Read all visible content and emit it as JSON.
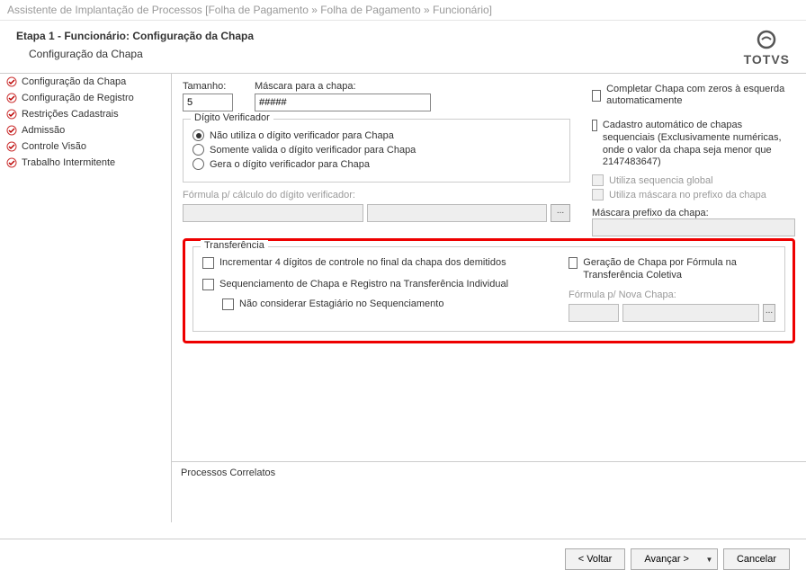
{
  "window_title": "Assistente de Implantação de Processos [Folha de Pagamento » Folha de Pagamento » Funcionário]",
  "step_title": "Etapa 1 - Funcionário: Configuração da Chapa",
  "step_subtitle": "Configuração da Chapa",
  "brand": "TOTVS",
  "sidebar": {
    "items": [
      {
        "label": "Configuração da Chapa"
      },
      {
        "label": "Configuração de Registro"
      },
      {
        "label": "Restrições Cadastrais"
      },
      {
        "label": "Admissão"
      },
      {
        "label": "Controle Visão"
      },
      {
        "label": "Trabalho Intermitente"
      }
    ]
  },
  "form": {
    "tamanho_label": "Tamanho:",
    "tamanho_value": "5",
    "mascara_label": "Máscara para a chapa:",
    "mascara_value": "#####",
    "completar_label": "Completar Chapa com zeros à esquerda automaticamente",
    "dv_legend": "Dígito Verificador",
    "dv_opt1": "Não utiliza o dígito verificador para Chapa",
    "dv_opt2": "Somente valida o dígito verificador para Chapa",
    "dv_opt3": "Gera o dígito verificador para Chapa",
    "cadastro_auto_label": "Cadastro automático de chapas sequenciais (Exclusivamente numéricas, onde o valor da chapa seja menor que 2147483647)",
    "seq_global_label": "Utiliza sequencia global",
    "mascara_prefixo_chk_label": "Utiliza máscara no prefixo da chapa",
    "formula_calc_label": "Fórmula p/ cálculo do dígito verificador:",
    "mascara_prefixo_label": "Máscara prefixo da chapa:",
    "transfer_legend": "Transferência",
    "t_inc_label": "Incrementar 4 dígitos de controle no final da chapa dos demitidos",
    "t_ger_label": "Geração de Chapa por Fórmula na Transferência Coletiva",
    "t_seq_label": "Sequenciamento de Chapa e Registro na Transferência Individual",
    "t_formula_nova_label": "Fórmula p/ Nova Chapa:",
    "t_nao_estag_label": "Não considerar Estagiário no Sequenciamento"
  },
  "processos_label": "Processos Correlatos",
  "buttons": {
    "voltar": "< Voltar",
    "avancar": "Avançar >",
    "cancelar": "Cancelar"
  }
}
